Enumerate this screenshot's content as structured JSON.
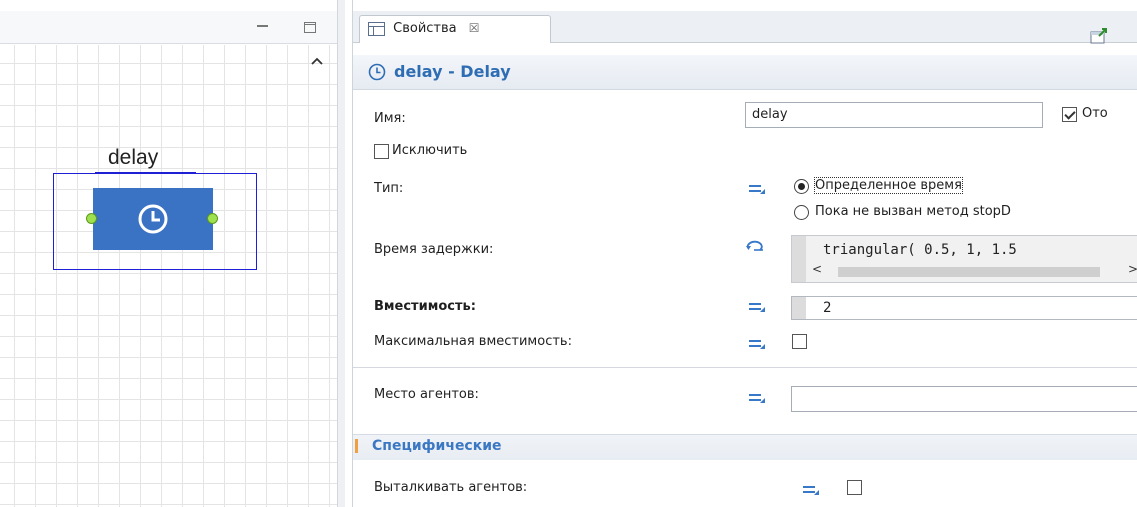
{
  "canvas": {
    "block_label": "delay"
  },
  "properties": {
    "tab_label": "Свойства",
    "tab_close": "☒",
    "header_title": "delay - Delay",
    "name_label": "Имя:",
    "name_value": "delay",
    "display_checkbox_label": "Ото",
    "exclude_label": "Исключить",
    "type_label": "Тип:",
    "type_option_1": "Определенное время",
    "type_option_2": "Пока не вызван метод stopD",
    "delay_time_label": "Время задержки:",
    "delay_time_value": "triangular( 0.5, 1, 1.5",
    "capacity_label": "Вместимость:",
    "capacity_value": "2",
    "max_capacity_label": "Максимальная вместимость:",
    "agent_location_label": "Место агентов:",
    "section_specific": "Специфические",
    "push_agents_label": "Выталкивать агентов:"
  },
  "colors": {
    "block_fill": "#3a72c4",
    "port_fill": "#9ee04d",
    "selection": "#1f1fd6",
    "header_text": "#2e6db4",
    "section_text": "#3b78c4"
  },
  "icons": {
    "minimize": "minimize-icon",
    "maximize": "maximize-icon",
    "clock": "clock-icon",
    "properties_tab": "properties-icon",
    "equals_param": "static-param-icon",
    "dynamic_param": "dynamic-param-icon"
  }
}
